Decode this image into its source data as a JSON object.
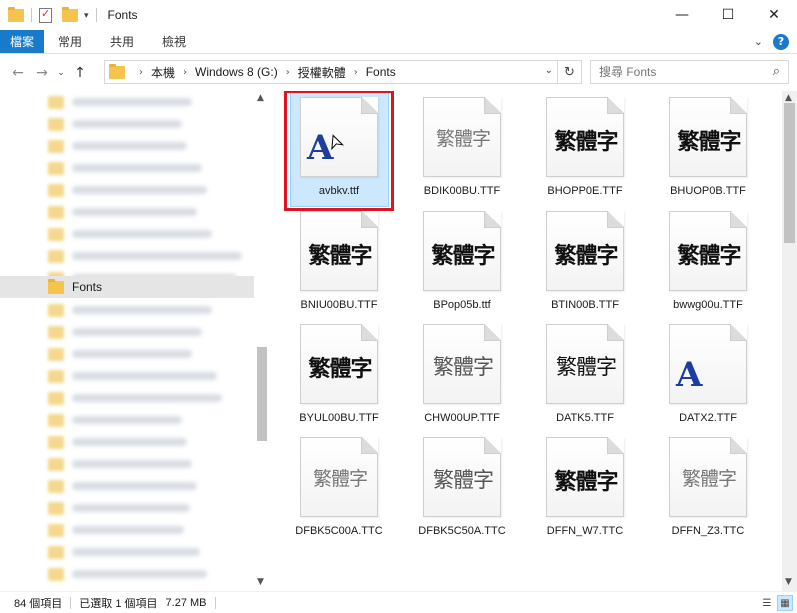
{
  "window": {
    "title": "Fonts",
    "minimize": "—",
    "maximize": "☐",
    "close": "✕"
  },
  "ribbon": {
    "tabs": [
      "檔案",
      "常用",
      "共用",
      "檢視"
    ],
    "collapse_icon": "chevron-down-icon",
    "help_icon": "help-icon"
  },
  "address": {
    "crumbs": [
      "本機",
      "Windows 8 (G:)",
      "授權軟體",
      "Fonts"
    ],
    "search_placeholder": "搜尋 Fonts"
  },
  "nav": {
    "selected_label": "Fonts"
  },
  "files": [
    {
      "name": "avbkv.ttf",
      "preview": "A",
      "style": "A",
      "selected": true
    },
    {
      "name": "BDIK00BU.TTF",
      "preview": "繁體字",
      "style": "thin"
    },
    {
      "name": "BHOPP0E.TTF",
      "preview": "繁體字",
      "style": "bold"
    },
    {
      "name": "BHUOP0B.TTF",
      "preview": "繁體字",
      "style": "bold"
    },
    {
      "name": "BNIU00BU.TTF",
      "preview": "繁體字",
      "style": "bold"
    },
    {
      "name": "BPop05b.ttf",
      "preview": "繁體字",
      "style": "bold"
    },
    {
      "name": "BTIN00B.TTF",
      "preview": "繁體字",
      "style": "bold"
    },
    {
      "name": "bwwg00u.TTF",
      "preview": "繁體字",
      "style": "bold"
    },
    {
      "name": "BYUL00BU.TTF",
      "preview": "繁體字",
      "style": "bold"
    },
    {
      "name": "CHW00UP.TTF",
      "preview": "繁體字",
      "style": "light"
    },
    {
      "name": "DATK5.TTF",
      "preview": "繁體字",
      "style": "normal"
    },
    {
      "name": "DATX2.TTF",
      "preview": "A",
      "style": "A"
    },
    {
      "name": "DFBK5C00A.TTC",
      "preview": "繁體字",
      "style": "thin"
    },
    {
      "name": "DFBK5C50A.TTC",
      "preview": "繁體字",
      "style": "light"
    },
    {
      "name": "DFFN_W7.TTC",
      "preview": "繁體字",
      "style": "bold"
    },
    {
      "name": "DFFN_Z3.TTC",
      "preview": "繁體字",
      "style": "thin"
    }
  ],
  "status": {
    "count": "84 個項目",
    "selection": "已選取 1 個項目",
    "size": "7.27 MB"
  },
  "colors": {
    "file_tab": "#1979ca",
    "selection_fill": "#cce8ff",
    "highlight_box": "#e0141e"
  }
}
